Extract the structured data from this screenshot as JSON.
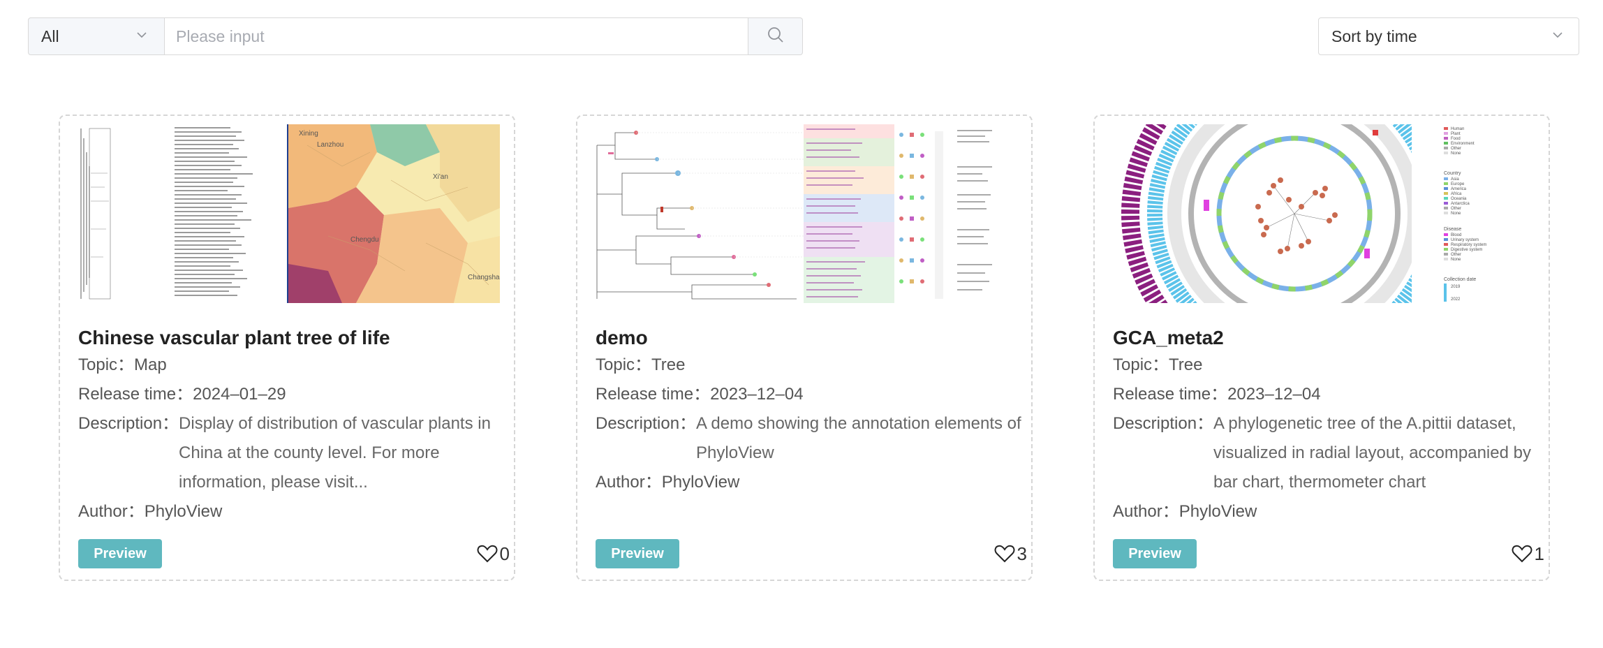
{
  "toolbar": {
    "filter_selected": "All",
    "search_placeholder": "Please input",
    "sort_selected": "Sort by time"
  },
  "labels": {
    "topic": "Topic：",
    "release": "Release time：",
    "description": "Description：",
    "author": "Author：",
    "preview": "Preview"
  },
  "cards": [
    {
      "title": "Chinese vascular plant tree of life",
      "topic": "Map",
      "release": "2024–01–29",
      "description": "Display of distribution of vascular plants in China at the county level. For more information, please visit...",
      "author": "PhyloView",
      "likes": "0",
      "thumb_text": {
        "c1": "Lanzhou",
        "c2": "Xi'an",
        "c3": "Chengdu",
        "c4": "Changsha",
        "c5": "Xining"
      }
    },
    {
      "title": "demo",
      "topic": "Tree",
      "release": "2023–12–04",
      "description": "A demo showing the annotation elements of PhyloView",
      "author": "PhyloView",
      "likes": "3"
    },
    {
      "title": "GCA_meta2",
      "topic": "Tree",
      "release": "2023–12–04",
      "description": "A phylogenetic tree of the A.pittii dataset, visualized in radial layout, accompanied by bar chart, thermometer chart",
      "author": "PhyloView",
      "likes": "1",
      "legend": {
        "h1": "Country",
        "h2": "Disease",
        "h3": "Collection date",
        "top": [
          "Human",
          "Plant",
          "Food",
          "Environment",
          "Other",
          "None"
        ],
        "country": [
          "Asia",
          "Europe",
          "America",
          "Africa",
          "Oceania",
          "Antarctica",
          "Other",
          "None"
        ],
        "disease": [
          "Blood",
          "Urinary system",
          "Respiratory system",
          "Digestive system",
          "Other",
          "None"
        ],
        "dates": [
          "2019",
          "2022"
        ]
      }
    }
  ],
  "colors": {
    "accent": "#5fb8bf",
    "map_orange": "#f2b97a",
    "map_red": "#d9746a",
    "map_yellow": "#f7eab0",
    "map_green": "#8fc9a8",
    "ring_purple": "#8b1f7f",
    "ring_blue": "#5bc3ea"
  }
}
